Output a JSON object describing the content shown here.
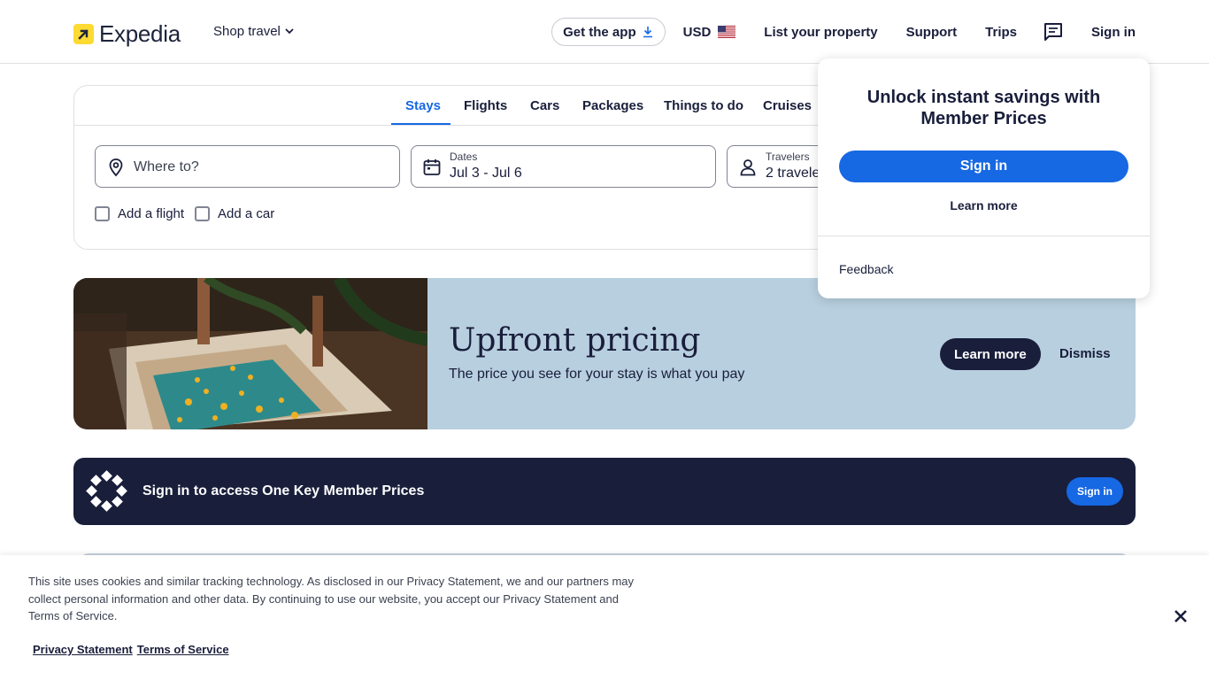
{
  "header": {
    "logo_text": "Expedia",
    "shop_travel": "Shop travel",
    "get_app": "Get the app",
    "currency": "USD",
    "list_property": "List your property",
    "support": "Support",
    "trips": "Trips",
    "sign_in": "Sign in"
  },
  "search": {
    "tabs": [
      {
        "label": "Stays",
        "active": true
      },
      {
        "label": "Flights"
      },
      {
        "label": "Cars"
      },
      {
        "label": "Packages"
      },
      {
        "label": "Things to do"
      },
      {
        "label": "Cruises"
      }
    ],
    "where_placeholder": "Where to?",
    "dates_label": "Dates",
    "dates_value": "Jul 3 - Jul 6",
    "travelers_label": "Travelers",
    "travelers_value": "2 travele",
    "add_flight": "Add a flight",
    "add_car": "Add a car"
  },
  "promo": {
    "title": "Upfront pricing",
    "subtitle": "The price you see for your stay is what you pay",
    "learn_more": "Learn more",
    "dismiss": "Dismiss"
  },
  "onekey": {
    "text": "Sign in to access One Key Member Prices",
    "button": "Sign in"
  },
  "popover": {
    "title": "Unlock instant savings with Member Prices",
    "sign_in": "Sign in",
    "learn_more": "Learn more",
    "feedback": "Feedback"
  },
  "cookie": {
    "text": "This site uses cookies and similar tracking technology. As disclosed in our Privacy Statement, we and our partners may collect personal information and other data. By continuing to use our website, you accept our Privacy Statement and Terms of Service.",
    "privacy": "Privacy Statement",
    "terms": "Terms of Service"
  },
  "colors": {
    "brand_navy": "#191e3b",
    "brand_blue": "#1668e3",
    "brand_yellow": "#fddb32",
    "promo_bg": "#b8cfdf"
  }
}
